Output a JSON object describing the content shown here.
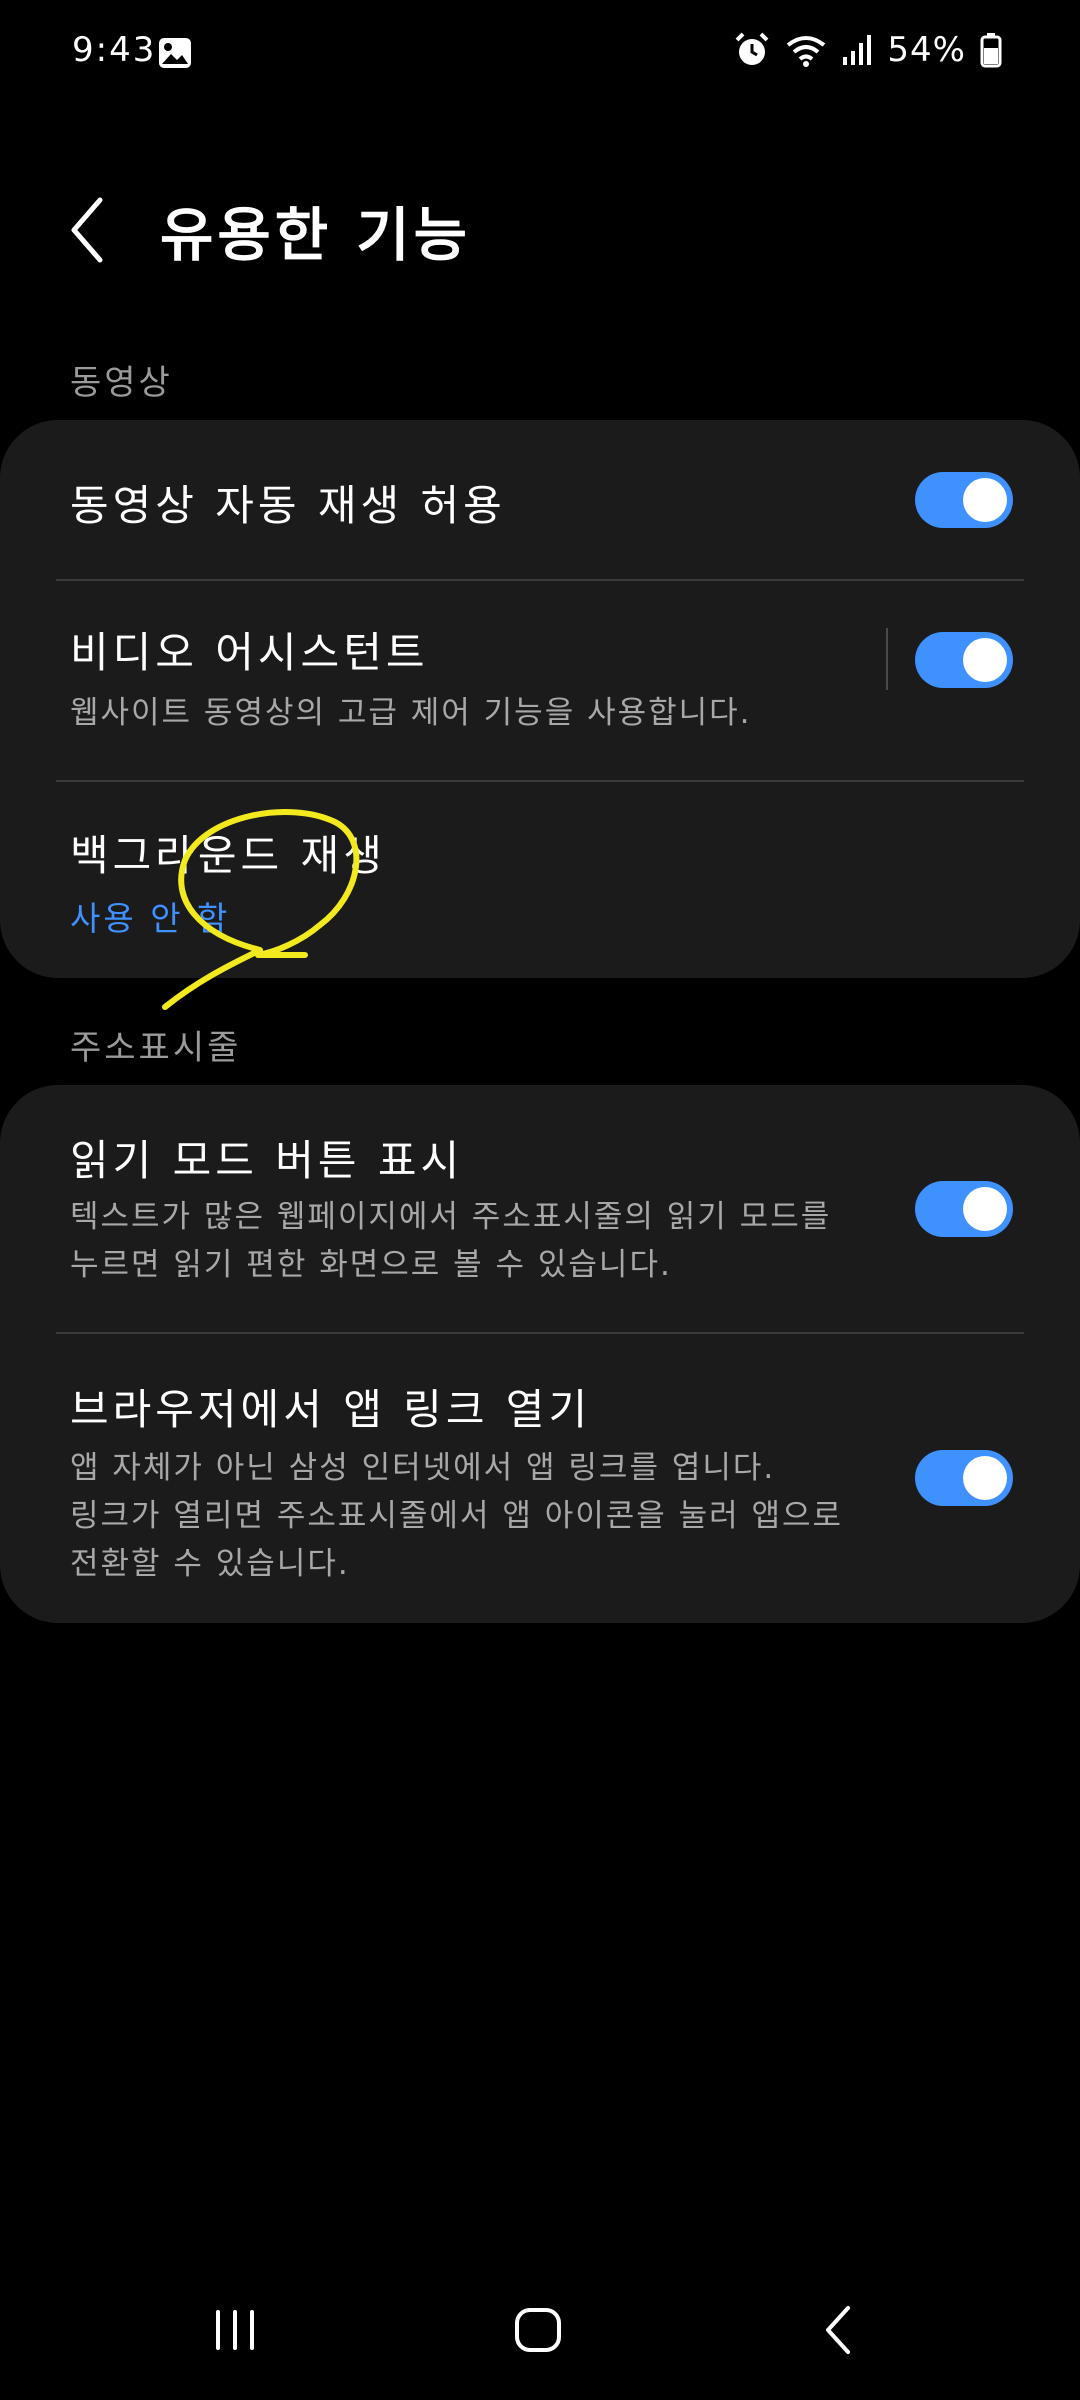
{
  "status_bar": {
    "time": "9:43",
    "battery": "54%"
  },
  "header": {
    "title": "유용한 기능"
  },
  "sections": [
    {
      "header": "동영상",
      "items": [
        {
          "title": "동영상 자동 재생 허용",
          "toggle_on": true
        },
        {
          "title": "비디오 어시스턴트",
          "description": "웹사이트 동영상의 고급 제어 기능을 사용합니다.",
          "toggle_on": true
        },
        {
          "title": "백그라운드 재생",
          "status": "사용 안 함"
        }
      ]
    },
    {
      "header": "주소표시줄",
      "items": [
        {
          "title": "읽기 모드 버튼 표시",
          "description_lines": [
            "텍스트가 많은 웹페이지에서 주소표시줄의 읽기 모드를",
            "누르면 읽기 편한 화면으로 볼 수 있습니다."
          ],
          "toggle_on": true
        },
        {
          "title": "브라우저에서 앱 링크 열기",
          "description_lines": [
            "앱 자체가 아닌 삼성 인터넷에서 앱 링크를 엽니다.",
            "링크가 열리면 주소표시줄에서 앱 아이콘을 눌러 앱으로",
            "전환할 수 있습니다."
          ],
          "toggle_on": true
        }
      ]
    }
  ],
  "colors": {
    "accent": "#3e91ff",
    "card": "#1b1b1b",
    "annotation": "#f2ea1f"
  },
  "icons": [
    "gallery-icon",
    "alarm-icon",
    "wifi-icon",
    "signal-icon",
    "battery-icon",
    "back-arrow-icon",
    "recents-icon",
    "home-icon",
    "nav-back-icon"
  ]
}
